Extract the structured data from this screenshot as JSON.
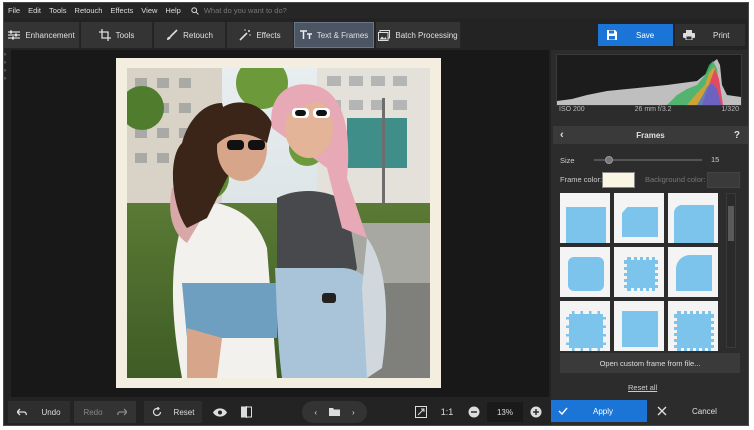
{
  "menu": {
    "items": [
      "File",
      "Edit",
      "Tools",
      "Retouch",
      "Effects",
      "View",
      "Help"
    ],
    "search_placeholder": "What do you want to do?"
  },
  "tabs": {
    "enhancement": "Enhancement",
    "tools": "Tools",
    "retouch": "Retouch",
    "effects": "Effects",
    "text_frames": "Text & Frames",
    "batch": "Batch Processing"
  },
  "actions": {
    "save": "Save",
    "print": "Print"
  },
  "exif": {
    "iso": "ISO 200",
    "lens": "26 mm f/3.2",
    "shutter": "1/320"
  },
  "frames_panel": {
    "title": "Frames",
    "size_label": "Size",
    "size_value": "15",
    "size_fraction": 0.15,
    "frame_color_label": "Frame color:",
    "frame_color": "#fbf5e3",
    "background_color_label": "Background color:",
    "open_custom": "Open custom frame from file...",
    "reset_all": "Reset all"
  },
  "bottom": {
    "undo": "Undo",
    "redo": "Redo",
    "reset": "Reset",
    "ratio": "1:1",
    "zoom": "13%",
    "apply": "Apply",
    "cancel": "Cancel"
  },
  "colors": {
    "accent": "#1b75d6",
    "active_tab": "#4b5564",
    "frame_thumb": "#7cc4ec"
  }
}
